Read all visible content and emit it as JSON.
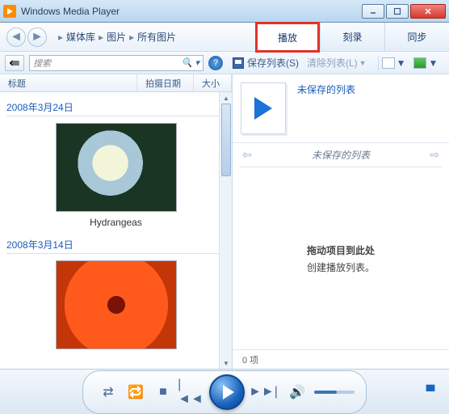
{
  "window": {
    "title": "Windows Media Player"
  },
  "breadcrumb": {
    "a": "媒体库",
    "b": "图片",
    "c": "所有图片"
  },
  "tabs": {
    "play": "播放",
    "burn": "刻录",
    "sync": "同步"
  },
  "toolbar": {
    "search_placeholder": "搜索",
    "save_list": "保存列表(S)",
    "clear_list": "清除列表(L)"
  },
  "columns": {
    "title": "标题",
    "date": "拍摄日期",
    "size": "大小"
  },
  "groups": [
    {
      "date": "2008年3月24日",
      "items": [
        {
          "name": "Hydrangeas"
        }
      ]
    },
    {
      "date": "2008年3月14日",
      "items": [
        {
          "name": ""
        }
      ]
    }
  ],
  "playlist": {
    "unsaved": "未保存的列表",
    "nav_label": "未保存的列表",
    "drop_line1": "拖动项目到此处",
    "drop_line2": "创建播放列表。",
    "count": "0 项"
  }
}
